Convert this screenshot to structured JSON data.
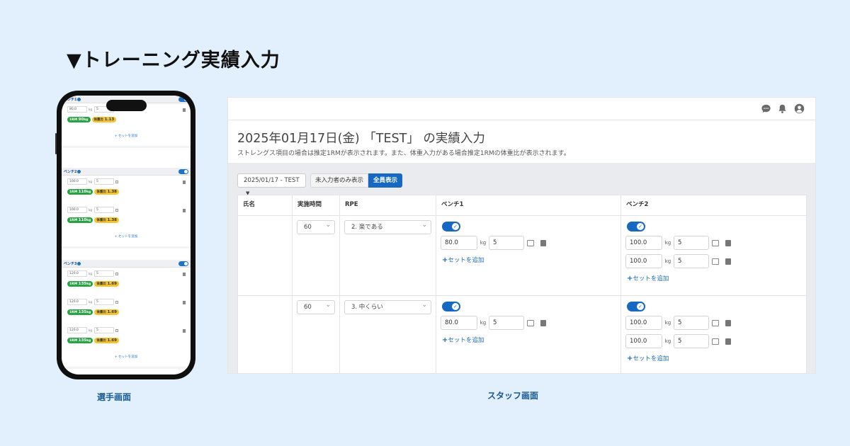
{
  "headline": "▼トレーニング実績入力",
  "caption_player": "選手画面",
  "caption_staff": "スタッフ画面",
  "phone": {
    "blocks": [
      {
        "title": "ベンチ1",
        "sets": [
          {
            "weight": "80.0",
            "unit": "kg",
            "reps": "5",
            "one_rm_label": "1RM",
            "one_rm": "90",
            "one_rm_unit": "kg",
            "ratio_label": "体重比",
            "ratio": "1.13"
          }
        ],
        "add_label": "セットを追加"
      },
      {
        "title": "ベンチ2",
        "sets": [
          {
            "weight": "100.0",
            "unit": "kg",
            "reps": "5",
            "one_rm_label": "1RM",
            "one_rm": "110",
            "one_rm_unit": "kg",
            "ratio_label": "体重比",
            "ratio": "1.38"
          },
          {
            "weight": "100.0",
            "unit": "kg",
            "reps": "5",
            "one_rm_label": "1RM",
            "one_rm": "110",
            "one_rm_unit": "kg",
            "ratio_label": "体重比",
            "ratio": "1.38"
          }
        ],
        "add_label": "セットを追加"
      },
      {
        "title": "ベンチ3",
        "sets": [
          {
            "weight": "120.0",
            "unit": "kg",
            "reps": "5",
            "one_rm_label": "1RM",
            "one_rm": "135",
            "one_rm_unit": "kg",
            "ratio_label": "体重比",
            "ratio": "1.69"
          },
          {
            "weight": "120.0",
            "unit": "kg",
            "reps": "5",
            "one_rm_label": "1RM",
            "one_rm": "135",
            "one_rm_unit": "kg",
            "ratio_label": "体重比",
            "ratio": "1.69"
          },
          {
            "weight": "120.0",
            "unit": "kg",
            "reps": "5",
            "one_rm_label": "1RM",
            "one_rm": "135",
            "one_rm_unit": "kg",
            "ratio_label": "体重比",
            "ratio": "1.69"
          }
        ],
        "add_label": "セットを追加"
      }
    ]
  },
  "staff": {
    "title": "2025年01月17日(金) 「TEST」 の実績入力",
    "subtitle": "ストレングス項目の場合は推定1RMが表示されます。また、体重入力がある場合推定1RMの体重比が表示されます。",
    "date_dropdown": "2025/01/17 - TEST",
    "btn_uninput": "未入力者のみ表示",
    "btn_all": "全員表示",
    "columns": [
      "氏名",
      "実施時間",
      "RPE",
      "ベンチ1",
      "ベンチ2"
    ],
    "rows": [
      {
        "name": "",
        "duration": "60",
        "rpe": "2. 楽である",
        "bench1": [
          {
            "weight": "80.0",
            "reps": "5"
          }
        ],
        "bench2": [
          {
            "weight": "100.0",
            "reps": "5"
          },
          {
            "weight": "100.0",
            "reps": "5"
          }
        ]
      },
      {
        "name": "",
        "duration": "60",
        "rpe": "3. 中くらい",
        "bench1": [
          {
            "weight": "80.0",
            "reps": "5"
          }
        ],
        "bench2": [
          {
            "weight": "100.0",
            "reps": "5"
          },
          {
            "weight": "100.0",
            "reps": "5"
          }
        ]
      }
    ],
    "unit": "kg",
    "add_set_label": "セットを追加",
    "toggle_check": "✓"
  },
  "colors": {
    "accent": "#1668c2",
    "badge_green": "#27a344",
    "badge_yellow": "#f4c430",
    "background": "#e1f0fc"
  }
}
